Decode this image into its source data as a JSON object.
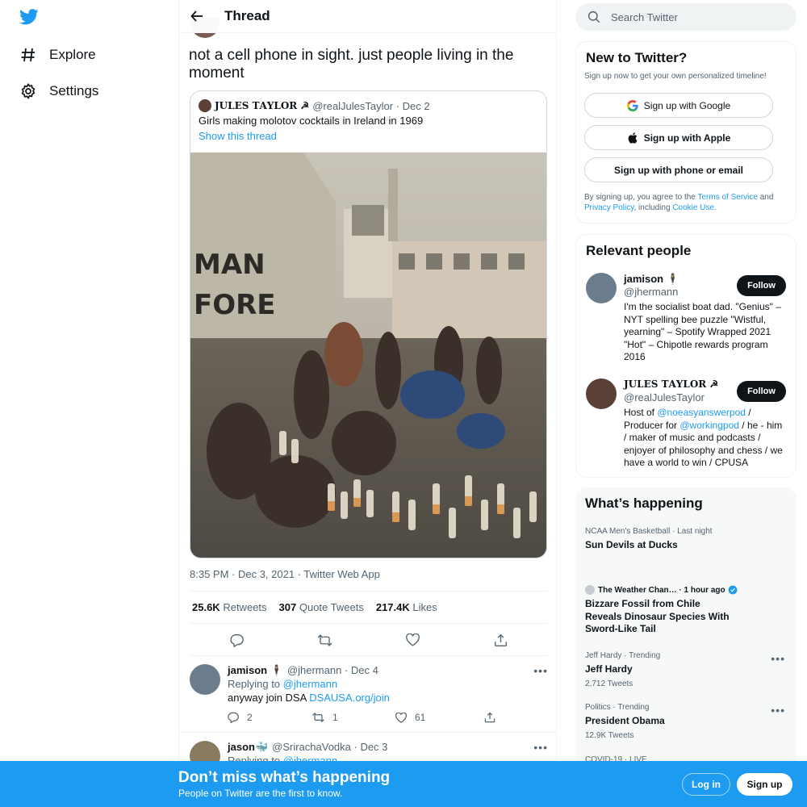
{
  "nav": {
    "items": [
      {
        "label": "Explore",
        "icon": "hashtag-icon"
      },
      {
        "label": "Settings",
        "icon": "gear-icon"
      }
    ]
  },
  "header": {
    "title": "Thread"
  },
  "tweet": {
    "text": "not a cell phone in sight. just people living in the moment",
    "quote": {
      "name": "𝐉𝐔𝐋𝐄𝐒 𝐓𝐀𝐘𝐋𝐎𝐑 ☭",
      "handle_date": "@realJulesTaylor · Dec 2",
      "text": "Girls making molotov cocktails in Ireland in 1969",
      "show_thread": "Show this thread"
    },
    "meta": "8:35 PM · Dec 3, 2021 · Twitter Web App",
    "stats": {
      "retweets": "25.6K",
      "retweets_label": "Retweets",
      "quotes": "307",
      "quotes_label": "Quote Tweets",
      "likes": "217.4K",
      "likes_label": "Likes"
    }
  },
  "replies": [
    {
      "name": "jamison 🕴",
      "handle_date": "@jhermann · Dec 4",
      "replying_prefix": "Replying to",
      "replying_to": "@jhermann",
      "text": "anyway join DSA",
      "link": "DSAUSA.org/join",
      "replies": "2",
      "retweets": "1",
      "likes": "61"
    },
    {
      "name": "jason🐳",
      "handle_date": "@SrirachaVodka · Dec 3",
      "replying_prefix": "Replying to",
      "replying_to": "@jhermann"
    }
  ],
  "search": {
    "placeholder": "Search Twitter"
  },
  "new_to_twitter": {
    "title": "New to Twitter?",
    "subtitle": "Sign up now to get your own personalized timeline!",
    "google": "Sign up with Google",
    "apple": "Sign up with Apple",
    "phone": "Sign up with phone or email",
    "terms_1": "By signing up, you agree to the",
    "terms_link": "Terms of Service",
    "terms_2": "and",
    "privacy": "Privacy Policy",
    "terms_3": ", including",
    "cookie": "Cookie Use."
  },
  "relevant": {
    "title": "Relevant people",
    "follow_label": "Follow",
    "people": [
      {
        "name": "jamison 🕴",
        "handle": "@jhermann",
        "bio": "I'm the socialist boat dad. \"Genius\" – NYT spelling bee puzzle \"Wistful, yearning\" – Spotify Wrapped 2021 \"Hot\" – Chipotle rewards program 2016"
      },
      {
        "name": "𝐉𝐔𝐋𝐄𝐒 𝐓𝐀𝐘𝐋𝐎𝐑 ☭",
        "handle": "@realJulesTaylor",
        "bio_1": "Host of",
        "bio_link1": "@noeasyanswerpod",
        "bio_2": "/ Producer for",
        "bio_link2": "@workingpod",
        "bio_3": "/ he - him / maker of music and podcasts / enjoyer of philosophy and chess / we have a world to win / CPUSA"
      }
    ]
  },
  "happening": {
    "title": "What’s happening",
    "trends": [
      {
        "category": "NCAA Men's Basketball · Last night",
        "title": "Sun Devils at Ducks"
      },
      {
        "category": "The Weather Chan… · 1 hour ago",
        "title": "Bizzare Fossil from Chile Reveals Dinosaur Species With Sword-Like Tail"
      },
      {
        "category": "Jeff Hardy · Trending",
        "title": "Jeff Hardy",
        "count": "2,712 Tweets"
      },
      {
        "category": "Politics · Trending",
        "title": "President Obama",
        "count": "12.9K Tweets"
      },
      {
        "category": "COVID-19 · LIVE"
      }
    ]
  },
  "bottom": {
    "title": "Don’t miss what’s happening",
    "subtitle": "People on Twitter are the first to know.",
    "login": "Log in",
    "signup": "Sign up"
  },
  "colors": {
    "accent": "#1d9bf0",
    "text": "#0f1419",
    "muted": "#536471"
  }
}
